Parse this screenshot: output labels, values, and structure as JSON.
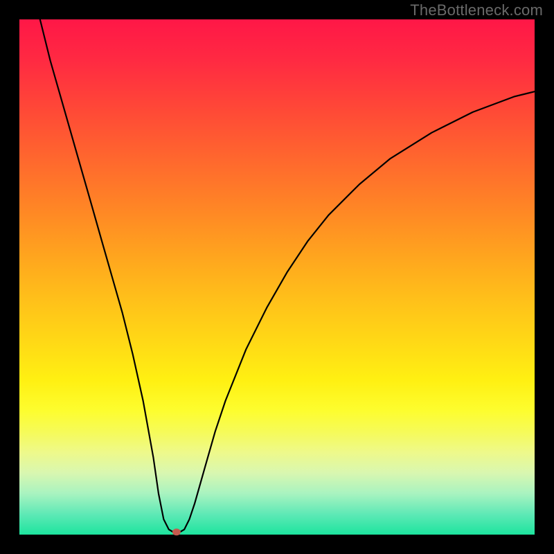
{
  "watermark": "TheBottleneck.com",
  "chart_data": {
    "type": "line",
    "title": "",
    "xlabel": "",
    "ylabel": "",
    "xlim": [
      0,
      100
    ],
    "ylim": [
      0,
      100
    ],
    "grid": false,
    "legend": false,
    "series": [
      {
        "name": "bottleneck-curve",
        "x": [
          4,
          6,
          8,
          10,
          12,
          14,
          16,
          18,
          20,
          22,
          24,
          26,
          27,
          28,
          29,
          30,
          31,
          32,
          33,
          34,
          36,
          38,
          40,
          44,
          48,
          52,
          56,
          60,
          66,
          72,
          80,
          88,
          96,
          100
        ],
        "y": [
          100,
          92,
          85,
          78,
          71,
          64,
          57,
          50,
          43,
          35,
          26,
          15,
          8,
          3,
          1,
          0.4,
          0.4,
          1,
          3,
          6,
          13,
          20,
          26,
          36,
          44,
          51,
          57,
          62,
          68,
          73,
          78,
          82,
          85,
          86
        ]
      }
    ],
    "annotations": [
      {
        "name": "optimum-marker",
        "x": 30.5,
        "y": 0.5
      }
    ],
    "background_gradient": {
      "top": "#ff1747",
      "bottom": "#1de49e"
    }
  }
}
